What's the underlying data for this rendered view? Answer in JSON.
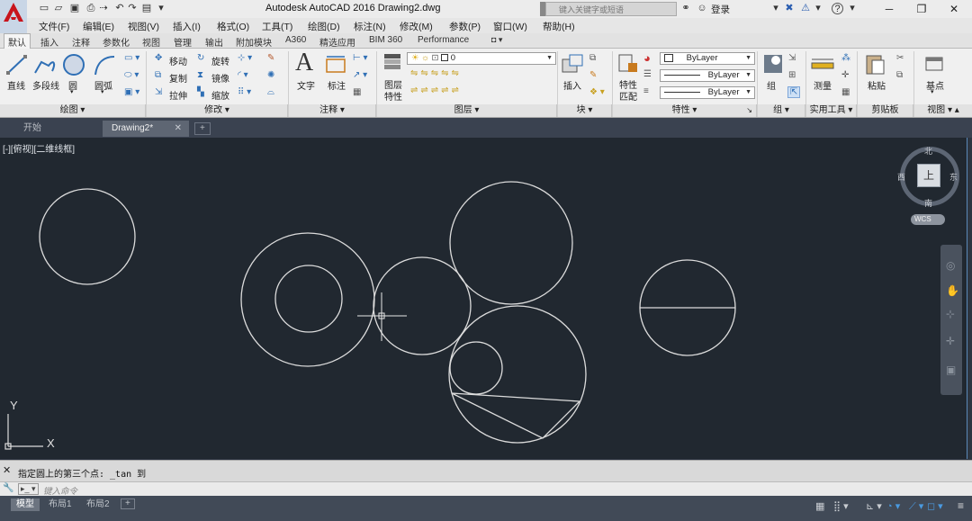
{
  "window": {
    "title": "Autodesk AutoCAD 2016    Drawing2.dwg",
    "search_placeholder": "键入关键字或短语",
    "login_label": "登录",
    "help_icon": "?"
  },
  "menu": [
    "文件(F)",
    "编辑(E)",
    "视图(V)",
    "插入(I)",
    "格式(O)",
    "工具(T)",
    "绘图(D)",
    "标注(N)",
    "修改(M)",
    "参数(P)",
    "窗口(W)",
    "帮助(H)"
  ],
  "ribbon_tabs": [
    "默认",
    "插入",
    "注释",
    "参数化",
    "视图",
    "管理",
    "输出",
    "附加模块",
    "A360",
    "精选应用",
    "BIM 360",
    "Performance"
  ],
  "ribbon": {
    "draw": {
      "panel": "绘图",
      "line": "直线",
      "polyline": "多段线",
      "circle": "圆",
      "arc": "圆弧"
    },
    "modify": {
      "panel": "修改",
      "move": "移动",
      "rotate": "旋转",
      "copy": "复制",
      "mirror": "镜像",
      "stretch": "拉伸",
      "scale": "缩放"
    },
    "annotation": {
      "panel": "注释",
      "text": "文字",
      "dimension": "标注"
    },
    "layers": {
      "panel": "图层",
      "layer_props_1": "图层",
      "layer_props_2": "特性",
      "current_layer": "0"
    },
    "block": {
      "panel": "块",
      "insert": "插入"
    },
    "properties": {
      "panel": "特性",
      "match_1": "特性",
      "match_2": "匹配",
      "color": "ByLayer",
      "linetype": "ByLayer",
      "lineweight": "ByLayer"
    },
    "groups": {
      "panel": "组",
      "group": "组"
    },
    "utilities": {
      "panel": "实用工具",
      "measure": "测量"
    },
    "clipboard": {
      "panel": "剪贴板",
      "paste": "粘贴"
    },
    "view": {
      "panel": "视图",
      "base": "基点"
    }
  },
  "doc_tabs": [
    "开始",
    "Drawing2*"
  ],
  "viewport_label": "[-][俯视][二维线框]",
  "viewcube": {
    "north": "北",
    "south": "南",
    "east": "东",
    "west": "西",
    "top": "上",
    "wcs": "WCS"
  },
  "ucs": {
    "x": "X",
    "y": "Y"
  },
  "command": {
    "history": "指定圆上的第三个点: _tan 到",
    "prompt_placeholder": "键入命令"
  },
  "layout_tabs": [
    "模型",
    "布局1",
    "布局2"
  ]
}
